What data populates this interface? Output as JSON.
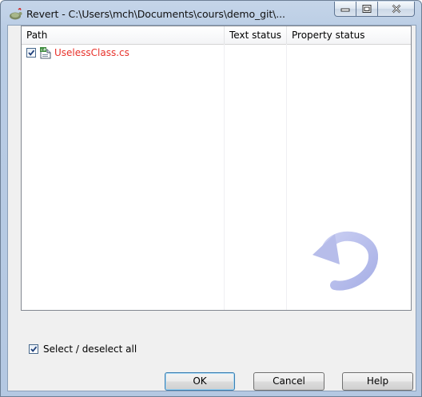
{
  "window": {
    "title": "Revert - C:\\Users\\mch\\Documents\\cours\\demo_git\\..."
  },
  "list": {
    "columns": [
      "Path",
      "Text status",
      "Property status"
    ],
    "rows": [
      {
        "path": "UselessClass.cs",
        "text_status": "",
        "property_status": "",
        "checked": true,
        "color": "#e8312a"
      }
    ]
  },
  "select_all": {
    "label": "Select / deselect all",
    "checked": true
  },
  "buttons": {
    "ok": "OK",
    "cancel": "Cancel",
    "help": "Help"
  },
  "icons": {
    "app": "tortoise-icon",
    "file": "cs-file-icon",
    "watermark": "revert-arrow-icon",
    "minimize": "minimize-icon",
    "maximize": "maximize-icon",
    "close": "close-icon"
  },
  "colors": {
    "modified_file": "#e8312a",
    "titlebar": "#b9cce4"
  }
}
